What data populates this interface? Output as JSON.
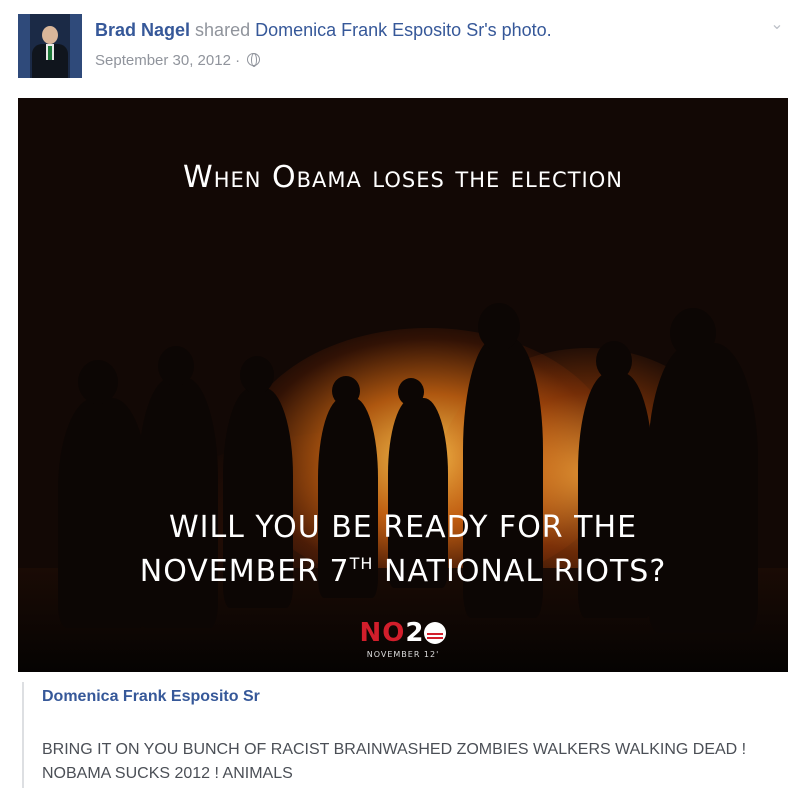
{
  "post": {
    "author": "Brad Nagel",
    "action": "shared",
    "source": "Domenica Frank Esposito Sr's photo.",
    "date": "September 30, 2012 ·",
    "privacy_icon": "globe-icon",
    "menu_icon": "chevron-down-icon"
  },
  "photo": {
    "caption_top": "When Obama loses the election",
    "caption_bottom_line1": "WILL YOU BE READY FOR THE",
    "caption_bottom_line2_pre": "NOVEMBER 7",
    "caption_bottom_line2_sup": "TH",
    "caption_bottom_line2_post": " NATIONAL RIOTS?",
    "logo_no": "NO",
    "logo_2": "2",
    "logo_sub": "NOVEMBER 12'"
  },
  "attachment": {
    "author": "Domenica Frank Esposito Sr",
    "text": "BRING IT ON YOU BUNCH OF RACIST BRAINWASHED ZOMBIES WALKERS WALKING DEAD ! NOBAMA SUCKS 2012 ! ANIMALS"
  },
  "colors": {
    "link": "#365899",
    "meta_grey": "#90949c",
    "logo_red": "#d21e2b"
  }
}
